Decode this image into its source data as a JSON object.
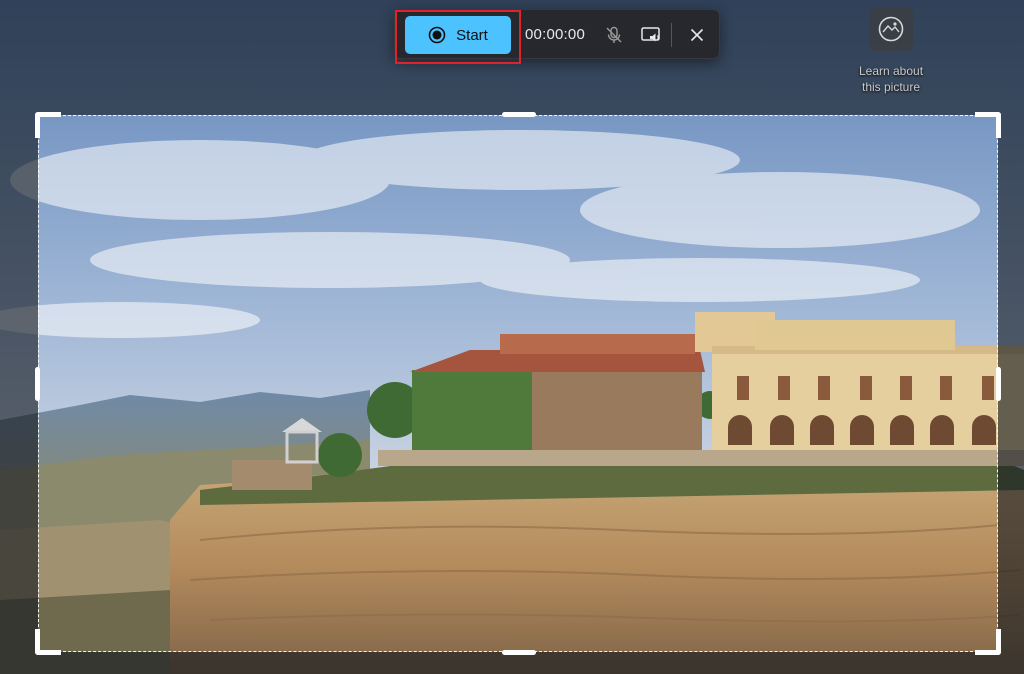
{
  "toolbar": {
    "start_label": "Start",
    "timer": "00:00:00",
    "icons": {
      "record": "record-icon",
      "mic_off": "microphone-off-icon",
      "cast": "cast-audio-icon",
      "close": "close-icon"
    }
  },
  "learn_picture": {
    "label_line1": "Learn about",
    "label_line2": "this picture",
    "icon": "camera-lens-icon"
  },
  "colors": {
    "start_button": "#4cc2ff",
    "highlight_outline": "#e0222b",
    "toolbar_bg": "#26282c"
  }
}
